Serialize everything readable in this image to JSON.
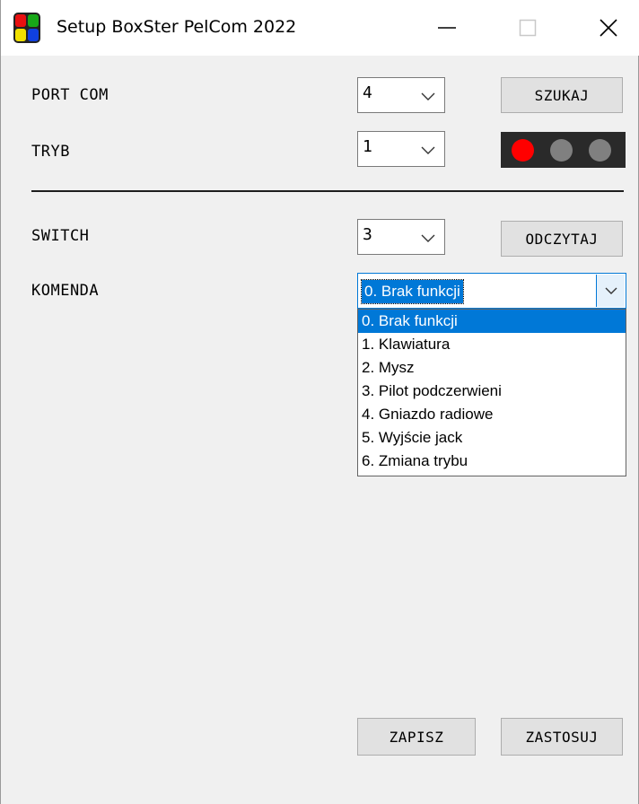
{
  "window": {
    "title": "Setup BoxSter PelCom 2022"
  },
  "titlebar_buttons": {
    "minimize_icon": "minimize-icon",
    "maximize_icon": "maximize-icon",
    "close_icon": "close-icon"
  },
  "labels": {
    "port_com": "PORT COM",
    "tryb": "TRYB",
    "switch": "SWITCH",
    "komenda": "KOMENDA"
  },
  "port_com": {
    "value": "4"
  },
  "tryb": {
    "value": "1"
  },
  "switch": {
    "value": "3"
  },
  "buttons": {
    "szukaj": "SZUKAJ",
    "odczytaj": "ODCZYTAJ",
    "zapisz": "ZAPISZ",
    "zastosuj": "ZASTOSUJ"
  },
  "indicator": {
    "dots": [
      {
        "color": "#ff0000"
      },
      {
        "color": "#808080"
      },
      {
        "color": "#808080"
      }
    ]
  },
  "komenda": {
    "value": "0. Brak funkcji",
    "options": [
      "0. Brak funkcji",
      "1. Klawiatura",
      "2. Mysz",
      "3. Pilot podczerwieni",
      "4. Gniazdo radiowe",
      "5. Wyjście jack",
      "6. Zmiana trybu"
    ],
    "selected_index": 0
  },
  "colors": {
    "accent": "#0078d7",
    "window_bg": "#f0f0f0",
    "indicator_bg": "#2a2a2a"
  }
}
